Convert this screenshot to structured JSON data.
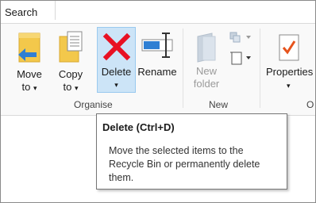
{
  "search": {
    "label": "Search"
  },
  "ribbon": {
    "move_to": {
      "line1": "Move",
      "line2": "to",
      "caret": "▾"
    },
    "copy_to": {
      "line1": "Copy",
      "line2": "to",
      "caret": "▾"
    },
    "delete": {
      "label": "Delete",
      "caret": "▾"
    },
    "rename": {
      "label": "Rename"
    },
    "new_folder": {
      "line1": "New",
      "line2": "folder"
    },
    "properties": {
      "label": "Properties",
      "caret": "▾"
    },
    "groups": {
      "organise": "Organise",
      "new": "New",
      "open_partial": "O"
    }
  },
  "tooltip": {
    "title": "Delete (Ctrl+D)",
    "body": "Move the selected items to the Recycle Bin or permanently delete them."
  },
  "colors": {
    "accent": "#cce4f7",
    "delete_red": "#e81123",
    "folder_yellow": "#f3c84b"
  }
}
